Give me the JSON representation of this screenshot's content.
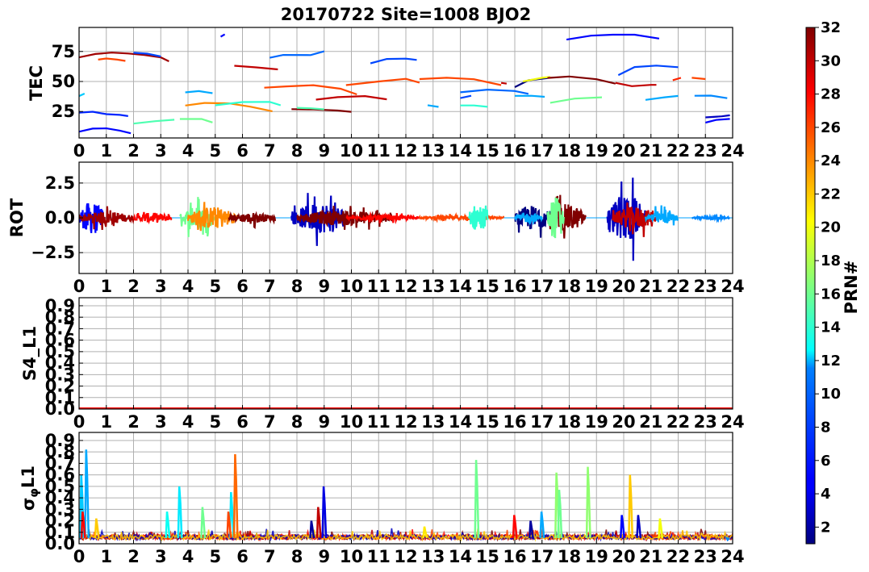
{
  "figure": {
    "title": "20170722 Site=1008 BJO2",
    "colorbar": {
      "label": "PRN#",
      "range": [
        1,
        32
      ],
      "ticks": [
        2,
        4,
        6,
        8,
        10,
        12,
        14,
        16,
        18,
        20,
        22,
        24,
        26,
        28,
        30,
        32
      ],
      "colormap": "jet"
    }
  },
  "chart_data": [
    {
      "type": "line",
      "panel": "tec",
      "ylabel": "TEC",
      "xlim": [
        0,
        24
      ],
      "ylim": [
        3,
        95
      ],
      "xticks": [
        0,
        1,
        2,
        3,
        4,
        5,
        6,
        7,
        8,
        9,
        10,
        11,
        12,
        13,
        14,
        15,
        16,
        17,
        18,
        19,
        20,
        21,
        22,
        23,
        24
      ],
      "yticks": [
        25,
        50,
        75
      ],
      "grid": true,
      "series": [
        {
          "prn": 31,
          "x": [
            0.0,
            0.6,
            1.2,
            1.8,
            2.4,
            3.0,
            3.3
          ],
          "y": [
            70,
            73,
            74,
            73,
            72,
            70,
            67
          ]
        },
        {
          "prn": 26,
          "x": [
            0.7,
            1.0,
            1.4,
            1.7
          ],
          "y": [
            68,
            69,
            68,
            67
          ]
        },
        {
          "prn": 7,
          "x": [
            2.0,
            2.5,
            3.0
          ],
          "y": [
            74,
            73,
            71
          ]
        },
        {
          "prn": 6,
          "x": [
            0.0,
            0.5,
            1.0,
            1.5,
            1.8
          ],
          "y": [
            24,
            25,
            23,
            22,
            21
          ]
        },
        {
          "prn": 5,
          "x": [
            0.0,
            0.5,
            1.0,
            1.5,
            1.9
          ],
          "y": [
            8,
            11,
            11,
            9,
            7
          ]
        },
        {
          "prn": 11,
          "x": [
            0.0,
            0.2
          ],
          "y": [
            38,
            40
          ]
        },
        {
          "prn": 5,
          "x": [
            5.2,
            5.35
          ],
          "y": [
            87,
            89
          ]
        },
        {
          "prn": 15,
          "x": [
            2.0,
            2.8,
            3.5
          ],
          "y": [
            15,
            17,
            18
          ]
        },
        {
          "prn": 16,
          "x": [
            3.7,
            4.5,
            4.9
          ],
          "y": [
            19,
            19,
            16
          ]
        },
        {
          "prn": 10,
          "x": [
            3.9,
            4.4,
            4.9
          ],
          "y": [
            41,
            42,
            40
          ]
        },
        {
          "prn": 24,
          "x": [
            3.9,
            4.6,
            5.5,
            6.3,
            7.1
          ],
          "y": [
            30,
            32,
            32,
            29,
            25
          ]
        },
        {
          "prn": 14,
          "x": [
            5.0,
            6.0,
            7.0,
            7.4
          ],
          "y": [
            30,
            33,
            33,
            30
          ]
        },
        {
          "prn": 30,
          "x": [
            5.7,
            6.5,
            7.3
          ],
          "y": [
            63,
            62,
            60
          ]
        },
        {
          "prn": 8,
          "x": [
            7.0,
            7.5,
            8.5,
            9.0
          ],
          "y": [
            70,
            72,
            72,
            75
          ]
        },
        {
          "prn": 26,
          "x": [
            6.8,
            7.6,
            8.6,
            9.6,
            10.2
          ],
          "y": [
            45,
            46,
            47,
            44,
            39
          ]
        },
        {
          "prn": 32,
          "x": [
            7.8,
            8.6,
            9.5,
            10.0
          ],
          "y": [
            27,
            27,
            26,
            25
          ]
        },
        {
          "prn": 15,
          "x": [
            8.0,
            8.5,
            9.0
          ],
          "y": [
            28,
            28,
            27
          ]
        },
        {
          "prn": 30,
          "x": [
            8.7,
            9.5,
            10.5,
            11.3
          ],
          "y": [
            35,
            37,
            38,
            35
          ]
        },
        {
          "prn": 26,
          "x": [
            9.8,
            11.0,
            12.0,
            12.5
          ],
          "y": [
            47,
            50,
            52,
            49
          ]
        },
        {
          "prn": 7,
          "x": [
            10.7,
            11.3,
            12.0,
            12.4
          ],
          "y": [
            65,
            69,
            69,
            68
          ]
        },
        {
          "prn": 26,
          "x": [
            12.5,
            13.5,
            14.5,
            15.5
          ],
          "y": [
            52,
            53,
            52,
            47
          ]
        },
        {
          "prn": 10,
          "x": [
            12.8,
            13.2
          ],
          "y": [
            30,
            29
          ]
        },
        {
          "prn": 8,
          "x": [
            14.0,
            15.0,
            16.0,
            16.5
          ],
          "y": [
            41,
            43,
            42,
            40
          ]
        },
        {
          "prn": 14,
          "x": [
            14.0,
            14.5,
            15.0
          ],
          "y": [
            30,
            30,
            29
          ]
        },
        {
          "prn": 7,
          "x": [
            14.0,
            14.4
          ],
          "y": [
            36,
            38
          ]
        },
        {
          "prn": 30,
          "x": [
            15.5,
            15.7
          ],
          "y": [
            49,
            48
          ]
        },
        {
          "prn": 1,
          "x": [
            16.0,
            16.5,
            17.2
          ],
          "y": [
            45,
            51,
            53
          ]
        },
        {
          "prn": 10,
          "x": [
            16.0,
            16.6,
            17.1
          ],
          "y": [
            38,
            38,
            37
          ]
        },
        {
          "prn": 20,
          "x": [
            16.3,
            17.0,
            17.3
          ],
          "y": [
            50,
            53,
            54
          ]
        },
        {
          "prn": 16,
          "x": [
            17.3,
            18.2,
            19.2
          ],
          "y": [
            32,
            36,
            37
          ]
        },
        {
          "prn": 32,
          "x": [
            17.2,
            18.0,
            19.0,
            19.7
          ],
          "y": [
            53,
            54,
            52,
            48
          ]
        },
        {
          "prn": 5,
          "x": [
            17.9,
            18.8,
            19.6,
            20.4,
            21.3
          ],
          "y": [
            85,
            88,
            89,
            89,
            86
          ]
        },
        {
          "prn": 30,
          "x": [
            19.7,
            20.3,
            21.0,
            21.2
          ],
          "y": [
            49,
            46,
            47,
            47
          ]
        },
        {
          "prn": 7,
          "x": [
            19.8,
            20.4,
            21.2,
            22.0
          ],
          "y": [
            55,
            62,
            63,
            62
          ]
        },
        {
          "prn": 10,
          "x": [
            20.8,
            21.5,
            22.0
          ],
          "y": [
            35,
            37,
            38
          ]
        },
        {
          "prn": 27,
          "x": [
            21.8,
            22.1
          ],
          "y": [
            51,
            53
          ]
        },
        {
          "prn": 26,
          "x": [
            22.5,
            23.0
          ],
          "y": [
            53,
            52
          ]
        },
        {
          "prn": 9,
          "x": [
            22.6,
            23.2,
            23.8
          ],
          "y": [
            38,
            38,
            36
          ]
        },
        {
          "prn": 5,
          "x": [
            23.0,
            23.4,
            23.9
          ],
          "y": [
            16,
            18,
            19
          ]
        },
        {
          "prn": 3,
          "x": [
            23.0,
            23.6,
            23.9
          ],
          "y": [
            20,
            21,
            22
          ]
        }
      ]
    },
    {
      "type": "line",
      "panel": "rot",
      "ylabel": "ROT",
      "xlim": [
        0,
        24
      ],
      "ylim": [
        -4,
        4
      ],
      "xticks": [
        0,
        1,
        2,
        3,
        4,
        5,
        6,
        7,
        8,
        9,
        10,
        11,
        12,
        13,
        14,
        15,
        16,
        17,
        18,
        19,
        20,
        21,
        22,
        23,
        24
      ],
      "yticks": [
        -2.5,
        0.0,
        2.5
      ],
      "ytick_labels": [
        "−2.5",
        "0.0",
        "2.5"
      ],
      "grid": true,
      "note": "noisy rate-of-TEC traces around 0; activity bursts",
      "bursts": [
        {
          "x0": 0.0,
          "x1": 0.9,
          "amp": 2.6,
          "prn": 5
        },
        {
          "x0": 0.0,
          "x1": 2.0,
          "amp": 1.0,
          "prn": 31
        },
        {
          "x0": 2.0,
          "x1": 3.4,
          "amp": 0.8,
          "prn": 28
        },
        {
          "x0": 3.7,
          "x1": 5.0,
          "amp": 1.8,
          "prn": 16
        },
        {
          "x0": 4.0,
          "x1": 5.8,
          "amp": 1.8,
          "prn": 24
        },
        {
          "x0": 5.5,
          "x1": 7.2,
          "amp": 0.8,
          "prn": 32
        },
        {
          "x0": 7.8,
          "x1": 10.0,
          "amp": 2.4,
          "prn": 3
        },
        {
          "x0": 8.0,
          "x1": 11.5,
          "amp": 1.2,
          "prn": 32
        },
        {
          "x0": 9.8,
          "x1": 12.5,
          "amp": 0.4,
          "prn": 28
        },
        {
          "x0": 12.5,
          "x1": 15.6,
          "amp": 0.3,
          "prn": 26
        },
        {
          "x0": 14.3,
          "x1": 15.0,
          "amp": 2.3,
          "prn": 14
        },
        {
          "x0": 16.0,
          "x1": 17.3,
          "amp": 2.0,
          "prn": 1
        },
        {
          "x0": 16.0,
          "x1": 17.0,
          "amp": 0.8,
          "prn": 10
        },
        {
          "x0": 17.2,
          "x1": 18.6,
          "amp": 2.2,
          "prn": 32
        },
        {
          "x0": 17.2,
          "x1": 17.8,
          "amp": 3.5,
          "prn": 16
        },
        {
          "x0": 19.4,
          "x1": 20.8,
          "amp": 3.8,
          "prn": 3
        },
        {
          "x0": 19.6,
          "x1": 21.2,
          "amp": 1.8,
          "prn": 30
        },
        {
          "x0": 20.8,
          "x1": 22.0,
          "amp": 1.0,
          "prn": 10
        },
        {
          "x0": 22.5,
          "x1": 23.9,
          "amp": 0.3,
          "prn": 9
        }
      ]
    },
    {
      "type": "line",
      "panel": "s4",
      "ylabel": "S4_L1",
      "xlim": [
        0,
        24
      ],
      "ylim": [
        0,
        0.97
      ],
      "xticks": [
        0,
        1,
        2,
        3,
        4,
        5,
        6,
        7,
        8,
        9,
        10,
        11,
        12,
        13,
        14,
        15,
        16,
        17,
        18,
        19,
        20,
        21,
        22,
        23,
        24
      ],
      "yticks": [
        0.0,
        0.1,
        0.2,
        0.3,
        0.4,
        0.5,
        0.6,
        0.7,
        0.8,
        0.9
      ],
      "ytick_labels": [
        "0.0",
        "0.1",
        "0.2",
        "0.3",
        "0.4",
        "0.5",
        "0.6",
        "0.7",
        "0.8",
        "0.9"
      ],
      "grid": true,
      "series": [
        {
          "prn": 28,
          "x": [
            0,
            24
          ],
          "y": [
            0.005,
            0.005
          ]
        }
      ]
    },
    {
      "type": "line",
      "panel": "sigma_phi",
      "ylabel": "σφL1",
      "ylabel_main": "σ",
      "ylabel_sub": "φ",
      "ylabel_rest": "L1",
      "xlim": [
        0,
        24
      ],
      "ylim": [
        0,
        0.97
      ],
      "xticks": [
        0,
        1,
        2,
        3,
        4,
        5,
        6,
        7,
        8,
        9,
        10,
        11,
        12,
        13,
        14,
        15,
        16,
        17,
        18,
        19,
        20,
        21,
        22,
        23,
        24
      ],
      "yticks": [
        0.0,
        0.1,
        0.2,
        0.3,
        0.4,
        0.5,
        0.6,
        0.7,
        0.8,
        0.9
      ],
      "ytick_labels": [
        "0.0",
        "0.1",
        "0.2",
        "0.3",
        "0.4",
        "0.5",
        "0.6",
        "0.7",
        "0.8",
        "0.9"
      ],
      "grid": true,
      "baseline": 0.05,
      "spikes": [
        {
          "x": 0.1,
          "y": 0.6,
          "prn": 11
        },
        {
          "x": 0.28,
          "y": 0.82,
          "prn": 10
        },
        {
          "x": 0.15,
          "y": 0.28,
          "prn": 28
        },
        {
          "x": 0.65,
          "y": 0.22,
          "prn": 22
        },
        {
          "x": 3.25,
          "y": 0.28,
          "prn": 13
        },
        {
          "x": 3.7,
          "y": 0.5,
          "prn": 12
        },
        {
          "x": 4.55,
          "y": 0.32,
          "prn": 16
        },
        {
          "x": 5.6,
          "y": 0.45,
          "prn": 12
        },
        {
          "x": 5.75,
          "y": 0.78,
          "prn": 25
        },
        {
          "x": 5.5,
          "y": 0.28,
          "prn": 26
        },
        {
          "x": 8.8,
          "y": 0.32,
          "prn": 30
        },
        {
          "x": 9.0,
          "y": 0.5,
          "prn": 4
        },
        {
          "x": 8.55,
          "y": 0.2,
          "prn": 2
        },
        {
          "x": 12.7,
          "y": 0.15,
          "prn": 21
        },
        {
          "x": 14.6,
          "y": 0.73,
          "prn": 16
        },
        {
          "x": 16.0,
          "y": 0.25,
          "prn": 28
        },
        {
          "x": 16.6,
          "y": 0.2,
          "prn": 2
        },
        {
          "x": 17.0,
          "y": 0.28,
          "prn": 10
        },
        {
          "x": 17.55,
          "y": 0.62,
          "prn": 17
        },
        {
          "x": 17.65,
          "y": 0.47,
          "prn": 16
        },
        {
          "x": 18.7,
          "y": 0.67,
          "prn": 17
        },
        {
          "x": 19.95,
          "y": 0.25,
          "prn": 5
        },
        {
          "x": 20.25,
          "y": 0.6,
          "prn": 22
        },
        {
          "x": 20.55,
          "y": 0.25,
          "prn": 3
        },
        {
          "x": 21.35,
          "y": 0.22,
          "prn": 20
        },
        {
          "x": 23.8,
          "y": 0.05,
          "prn": 9
        }
      ]
    }
  ]
}
